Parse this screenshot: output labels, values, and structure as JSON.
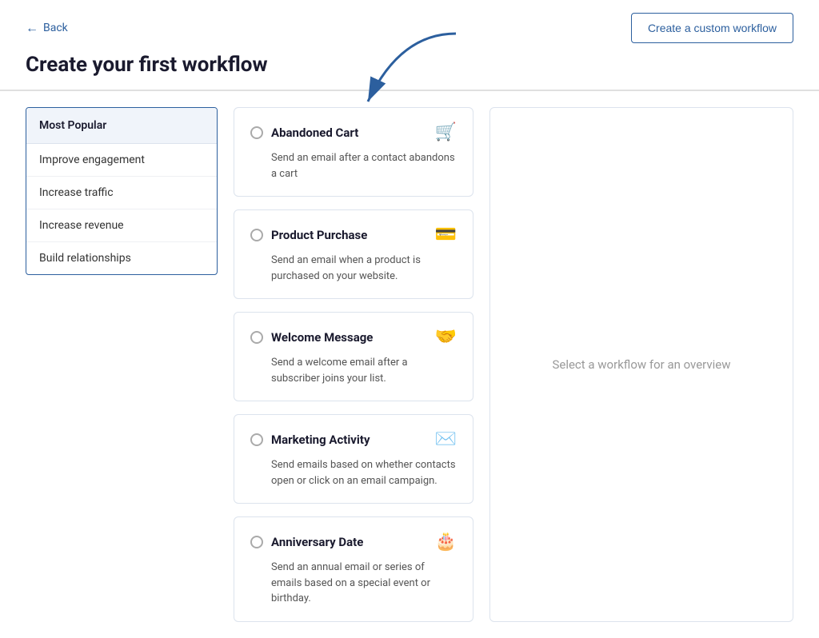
{
  "back": {
    "label": "Back"
  },
  "header": {
    "title": "Create your first workflow",
    "create_custom_btn": "Create a custom workflow"
  },
  "sidebar": {
    "header": "Most Popular",
    "items": [
      {
        "label": "Improve engagement"
      },
      {
        "label": "Increase traffic"
      },
      {
        "label": "Increase revenue"
      },
      {
        "label": "Build relationships"
      }
    ]
  },
  "workflows": [
    {
      "title": "Abandoned Cart",
      "description": "Send an email after a contact abandons a cart",
      "icon": "🛒"
    },
    {
      "title": "Product Purchase",
      "description": "Send an email when a product is purchased on your website.",
      "icon": "💳"
    },
    {
      "title": "Welcome Message",
      "description": "Send a welcome email after a subscriber joins your list.",
      "icon": "🤝"
    },
    {
      "title": "Marketing Activity",
      "description": "Send emails based on whether contacts open or click on an email campaign.",
      "icon": "✉️"
    },
    {
      "title": "Anniversary Date",
      "description": "Send an annual email or series of emails based on a special event or birthday.",
      "icon": "🎂"
    }
  ],
  "right_panel": {
    "placeholder": "Select a workflow for an overview"
  }
}
